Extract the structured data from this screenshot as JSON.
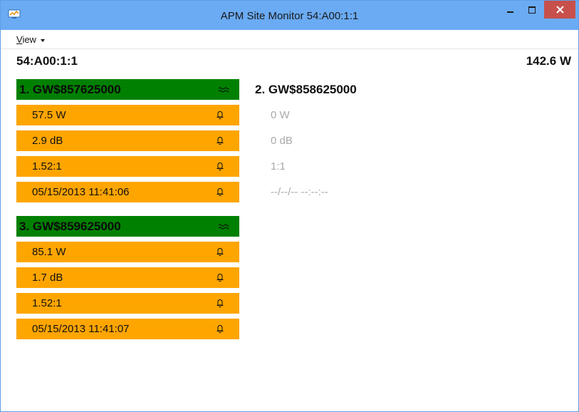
{
  "window": {
    "title": "APM Site Monitor 54:A00:1:1",
    "icon": "app-monitor-icon",
    "controls": [
      "minimize-icon",
      "maximize-icon",
      "close-icon"
    ]
  },
  "menu": {
    "view_label": "View",
    "view_accel": "V",
    "view_rest": "iew"
  },
  "site": {
    "id": "54:A00:1:1",
    "total_power": "142.6 W"
  },
  "colors": {
    "titlebar": "#6aabf3",
    "close_button": "#c7504c",
    "active_header": "#008000",
    "alarm_row": "#ffa500",
    "idle_text": "#a9a9a9"
  },
  "channels": [
    {
      "label": "1. GW$857625000",
      "state": "active",
      "header_icon": "signal-wave-icon",
      "rows": [
        {
          "value": "57.5 W",
          "icon": "alarm-bell-icon"
        },
        {
          "value": "2.9 dB",
          "icon": "alarm-bell-icon"
        },
        {
          "value": "1.52:1",
          "icon": "alarm-bell-icon"
        },
        {
          "value": "05/15/2013 11:41:06",
          "icon": "alarm-bell-icon"
        }
      ]
    },
    {
      "label": "2. GW$858625000",
      "state": "inactive",
      "rows": [
        {
          "value": "0 W"
        },
        {
          "value": "0 dB"
        },
        {
          "value": "1:1"
        },
        {
          "value": "--/--/-- --:--:--"
        }
      ]
    },
    {
      "label": "3. GW$859625000",
      "state": "active",
      "header_icon": "signal-wave-icon",
      "rows": [
        {
          "value": "85.1 W",
          "icon": "alarm-bell-icon"
        },
        {
          "value": "1.7 dB",
          "icon": "alarm-bell-icon"
        },
        {
          "value": "1.52:1",
          "icon": "alarm-bell-icon"
        },
        {
          "value": "05/15/2013 11:41:07",
          "icon": "alarm-bell-icon"
        }
      ]
    }
  ]
}
